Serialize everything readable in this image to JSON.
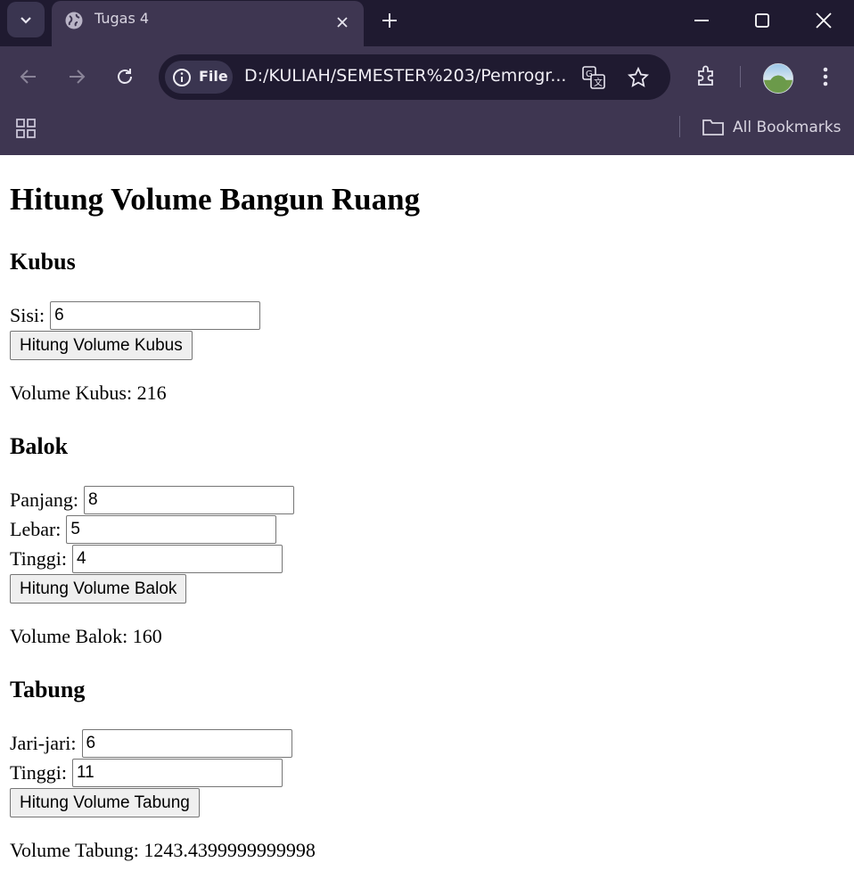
{
  "browser": {
    "tab_title": "Tugas 4",
    "chip_label": "File",
    "url": "D:/KULIAH/SEMESTER%203/Pemrogr...",
    "bookmarks_label": "All Bookmarks"
  },
  "page": {
    "title": "Hitung Volume Bangun Ruang",
    "kubus": {
      "heading": "Kubus",
      "sisi_label": "Sisi:",
      "sisi_value": "6",
      "button": "Hitung Volume Kubus",
      "result": "Volume Kubus: 216"
    },
    "balok": {
      "heading": "Balok",
      "panjang_label": "Panjang:",
      "panjang_value": "8",
      "lebar_label": "Lebar:",
      "lebar_value": "5",
      "tinggi_label": "Tinggi:",
      "tinggi_value": "4",
      "button": "Hitung Volume Balok",
      "result": "Volume Balok: 160"
    },
    "tabung": {
      "heading": "Tabung",
      "jari_label": "Jari-jari:",
      "jari_value": "6",
      "tinggi_label": "Tinggi:",
      "tinggi_value": "11",
      "button": "Hitung Volume Tabung",
      "result": "Volume Tabung: 1243.4399999999998"
    }
  }
}
